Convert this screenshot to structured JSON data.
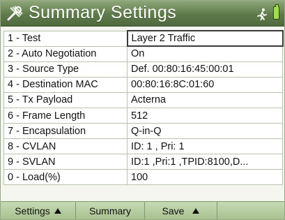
{
  "header": {
    "title": "Summary Settings",
    "icons": [
      "settings-tools-icon",
      "running-man-icon",
      "battery-icon"
    ],
    "title_color": "#ffffff",
    "bar_color": "#5f7a4a"
  },
  "settings": [
    {
      "label": "1 - Test",
      "value": "Layer 2 Traffic"
    },
    {
      "label": "2 - Auto Negotiation",
      "value": "On"
    },
    {
      "label": "3 - Source Type",
      "value": "Def.  00:80:16:45:00:01"
    },
    {
      "label": "4 - Destination MAC",
      "value": "00:80:16:8C:01:60"
    },
    {
      "label": "5 - Tx Payload",
      "value": "Acterna"
    },
    {
      "label": "6 - Frame Length",
      "value": "512"
    },
    {
      "label": "7 - Encapsulation",
      "value": "Q-in-Q"
    },
    {
      "label": "8 - CVLAN",
      "value": "ID: 1 , Pri: 1"
    },
    {
      "label": "9 - SVLAN",
      "value": "ID:1 ,Pri:1 ,TPID:8100,D..."
    },
    {
      "label": "0 - Load(%)",
      "value": "100"
    }
  ],
  "softkeys": [
    {
      "label": "Settings",
      "arrow": true
    },
    {
      "label": "Summary",
      "arrow": false
    },
    {
      "label": "Save",
      "arrow": true
    },
    {
      "label": "",
      "arrow": false
    }
  ]
}
